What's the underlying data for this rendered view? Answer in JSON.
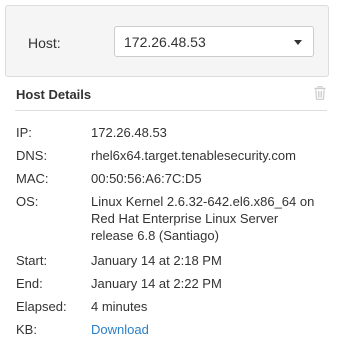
{
  "host_selector": {
    "label": "Host:",
    "selected": "172.26.48.53"
  },
  "details": {
    "title": "Host Details",
    "rows": [
      {
        "key": "IP:",
        "value": "172.26.48.53"
      },
      {
        "key": "DNS:",
        "value": "rhel6x64.target.tenablesecurity.com"
      },
      {
        "key": "MAC:",
        "value": "00:50:56:A6:7C:D5"
      },
      {
        "key": "OS:",
        "value": "Linux Kernel 2.6.32-642.el6.x86_64 on Red Hat Enterprise Linux Server release 6.8 (Santiago)"
      },
      {
        "key": "Start:",
        "value": "January 14 at 2:18 PM"
      },
      {
        "key": "End:",
        "value": "January 14 at 2:22 PM"
      },
      {
        "key": "Elapsed:",
        "value": "4 minutes"
      },
      {
        "key": "KB:",
        "value": "Download"
      }
    ]
  },
  "colors": {
    "link": "#2a7fc9",
    "panel_bg": "#f5f5f5",
    "icon_muted": "#cccccc"
  },
  "icons": {
    "dropdown": "caret-down-icon",
    "delete": "trash-icon"
  }
}
